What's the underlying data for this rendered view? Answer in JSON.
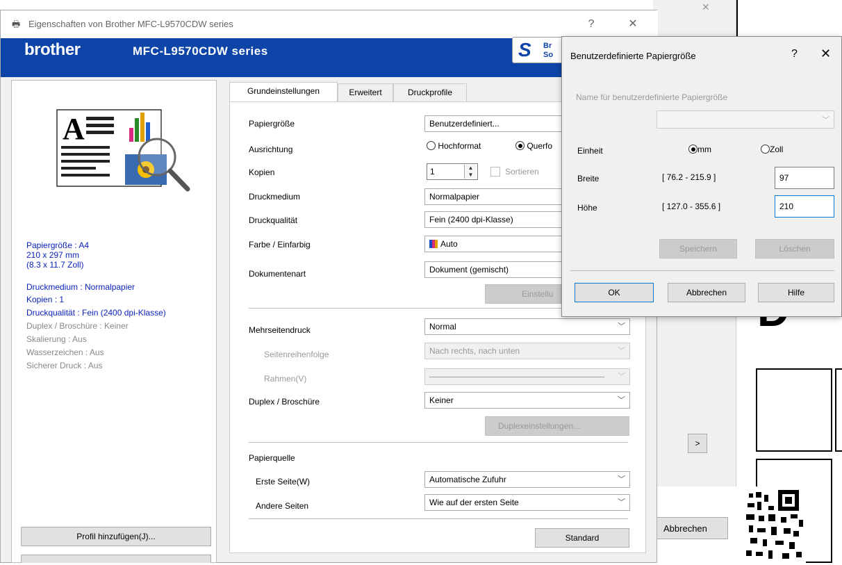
{
  "bg_window": {
    "small_button": ">",
    "cancel_button": "Abbrechen",
    "big_text": "D"
  },
  "main": {
    "title": "Eigenschaften von Brother MFC-L9570CDW series",
    "help": "?",
    "close": "✕",
    "brand": "brother",
    "model": "MFC-L9570CDW series",
    "sbtn_text": [
      "Br",
      "So"
    ]
  },
  "left": {
    "info": [
      "Papiergröße : A4",
      "210 x 297 mm",
      "(8.3 x 11.7 Zoll)",
      "Druckmedium : Normalpapier",
      "Kopien : 1",
      "Druckqualität : Fein (2400 dpi-Klasse)",
      "Duplex / Broschüre : Keiner",
      "Skalierung : Aus",
      "Wasserzeichen : Aus",
      "Sicherer Druck : Aus"
    ],
    "profile_button": "Profil hinzufügen(J)..."
  },
  "tabs": [
    "Grundeinstellungen",
    "Erweitert",
    "Druckprofile"
  ],
  "form": {
    "paper_size_label": "Papiergröße",
    "paper_size_value": "Benutzerdefiniert...",
    "orientation_label": "Ausrichtung",
    "portrait": "Hochformat",
    "landscape": "Querfo",
    "copies_label": "Kopien",
    "copies_value": "1",
    "collate": "Sortieren",
    "media_label": "Druckmedium",
    "media_value": "Normalpapier",
    "quality_label": "Druckqualität",
    "quality_value": "Fein (2400 dpi-Klasse)",
    "color_label": "Farbe / Einfarbig",
    "color_value": "Auto",
    "doctype_label": "Dokumentenart",
    "doctype_value": "Dokument (gemischt)",
    "settings_button": "Einstellu",
    "multipage_label": "Mehrseitendruck",
    "multipage_value": "Normal",
    "page_order_label": "Seitenreihenfolge",
    "page_order_value": "Nach rechts, nach unten",
    "border_label": "Rahmen(V)",
    "duplex_label": "Duplex / Broschüre",
    "duplex_value": "Keiner",
    "duplex_settings_button": "Duplexeinstellungen...",
    "source_label": "Papierquelle",
    "first_page_label": "Erste Seite(W)",
    "first_page_value": "Automatische Zufuhr",
    "other_pages_label": "Andere Seiten",
    "other_pages_value": "Wie auf der ersten Seite",
    "standard_button": "Standard"
  },
  "custom_dialog": {
    "title": "Benutzerdefinierte Papiergröße",
    "help": "?",
    "close": "✕",
    "name_label": "Name für benutzerdefinierte Papiergröße",
    "unit_label": "Einheit",
    "unit_mm": "mm",
    "unit_inch": "Zoll",
    "width_label": "Breite",
    "width_range": "[ 76.2 - 215.9 ]",
    "width_value": "97",
    "height_label": "Höhe",
    "height_range": "[ 127.0 - 355.6 ]",
    "height_value": "210",
    "save_button": "Speichern",
    "delete_button": "Löschen",
    "ok_button": "OK",
    "cancel_button": "Abbrechen",
    "help_button": "Hilfe"
  }
}
